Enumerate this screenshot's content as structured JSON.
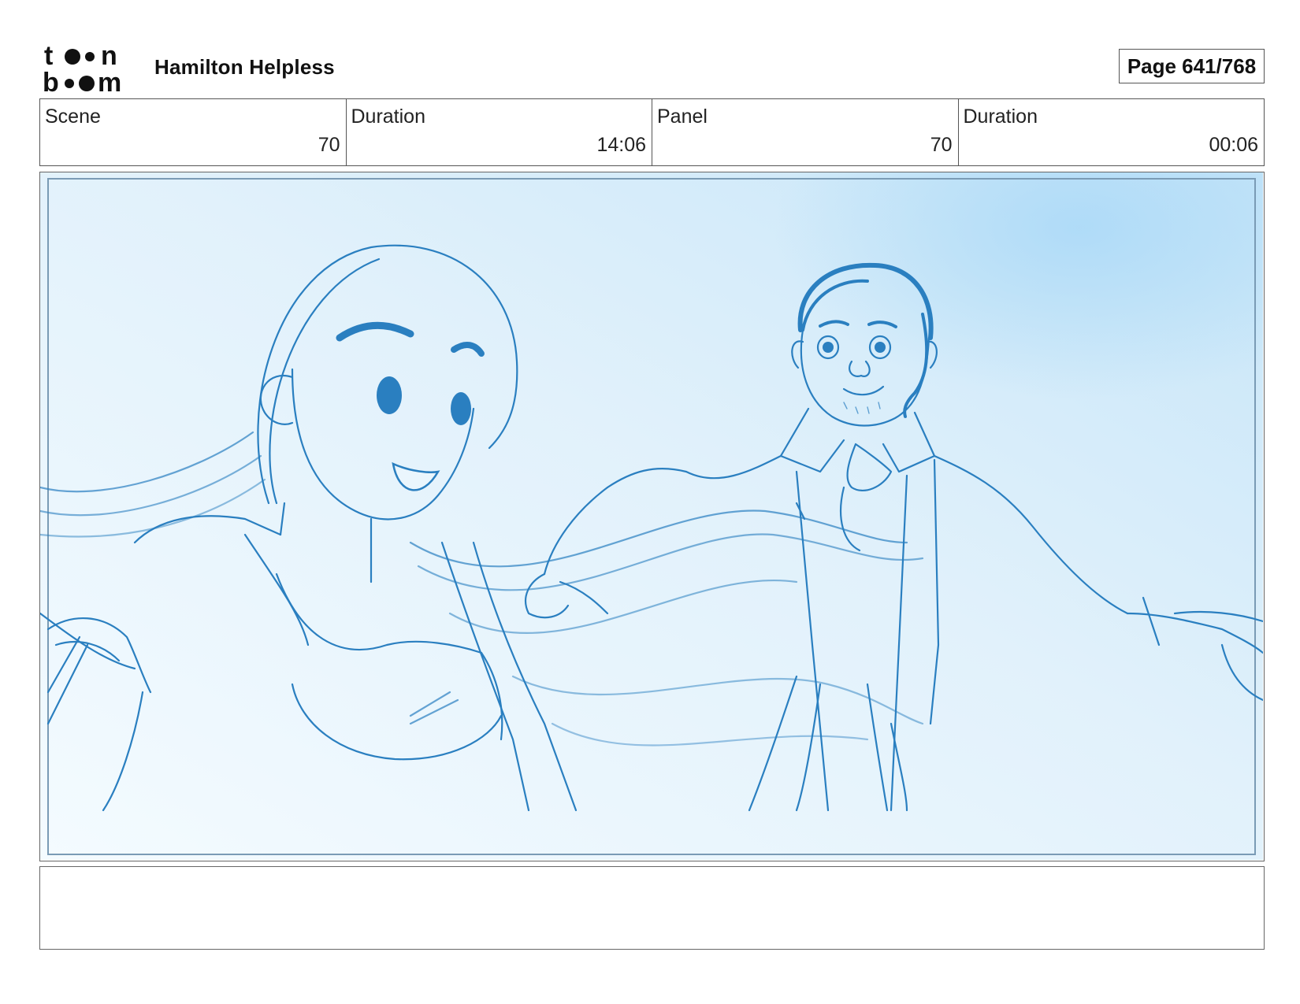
{
  "header": {
    "logo_text": "toon boom",
    "project_title": "Hamilton Helpless",
    "page_indicator": "Page 641/768"
  },
  "info": {
    "scene_label": "Scene",
    "scene_value": "70",
    "scene_duration_label": "Duration",
    "scene_duration_value": "14:06",
    "panel_label": "Panel",
    "panel_value": "70",
    "panel_duration_label": "Duration",
    "panel_duration_value": "00:06"
  },
  "colors": {
    "sketch_line": "#2a7fc0",
    "sky_light": "#eef7fd",
    "sky_mid": "#cfe8f8"
  }
}
